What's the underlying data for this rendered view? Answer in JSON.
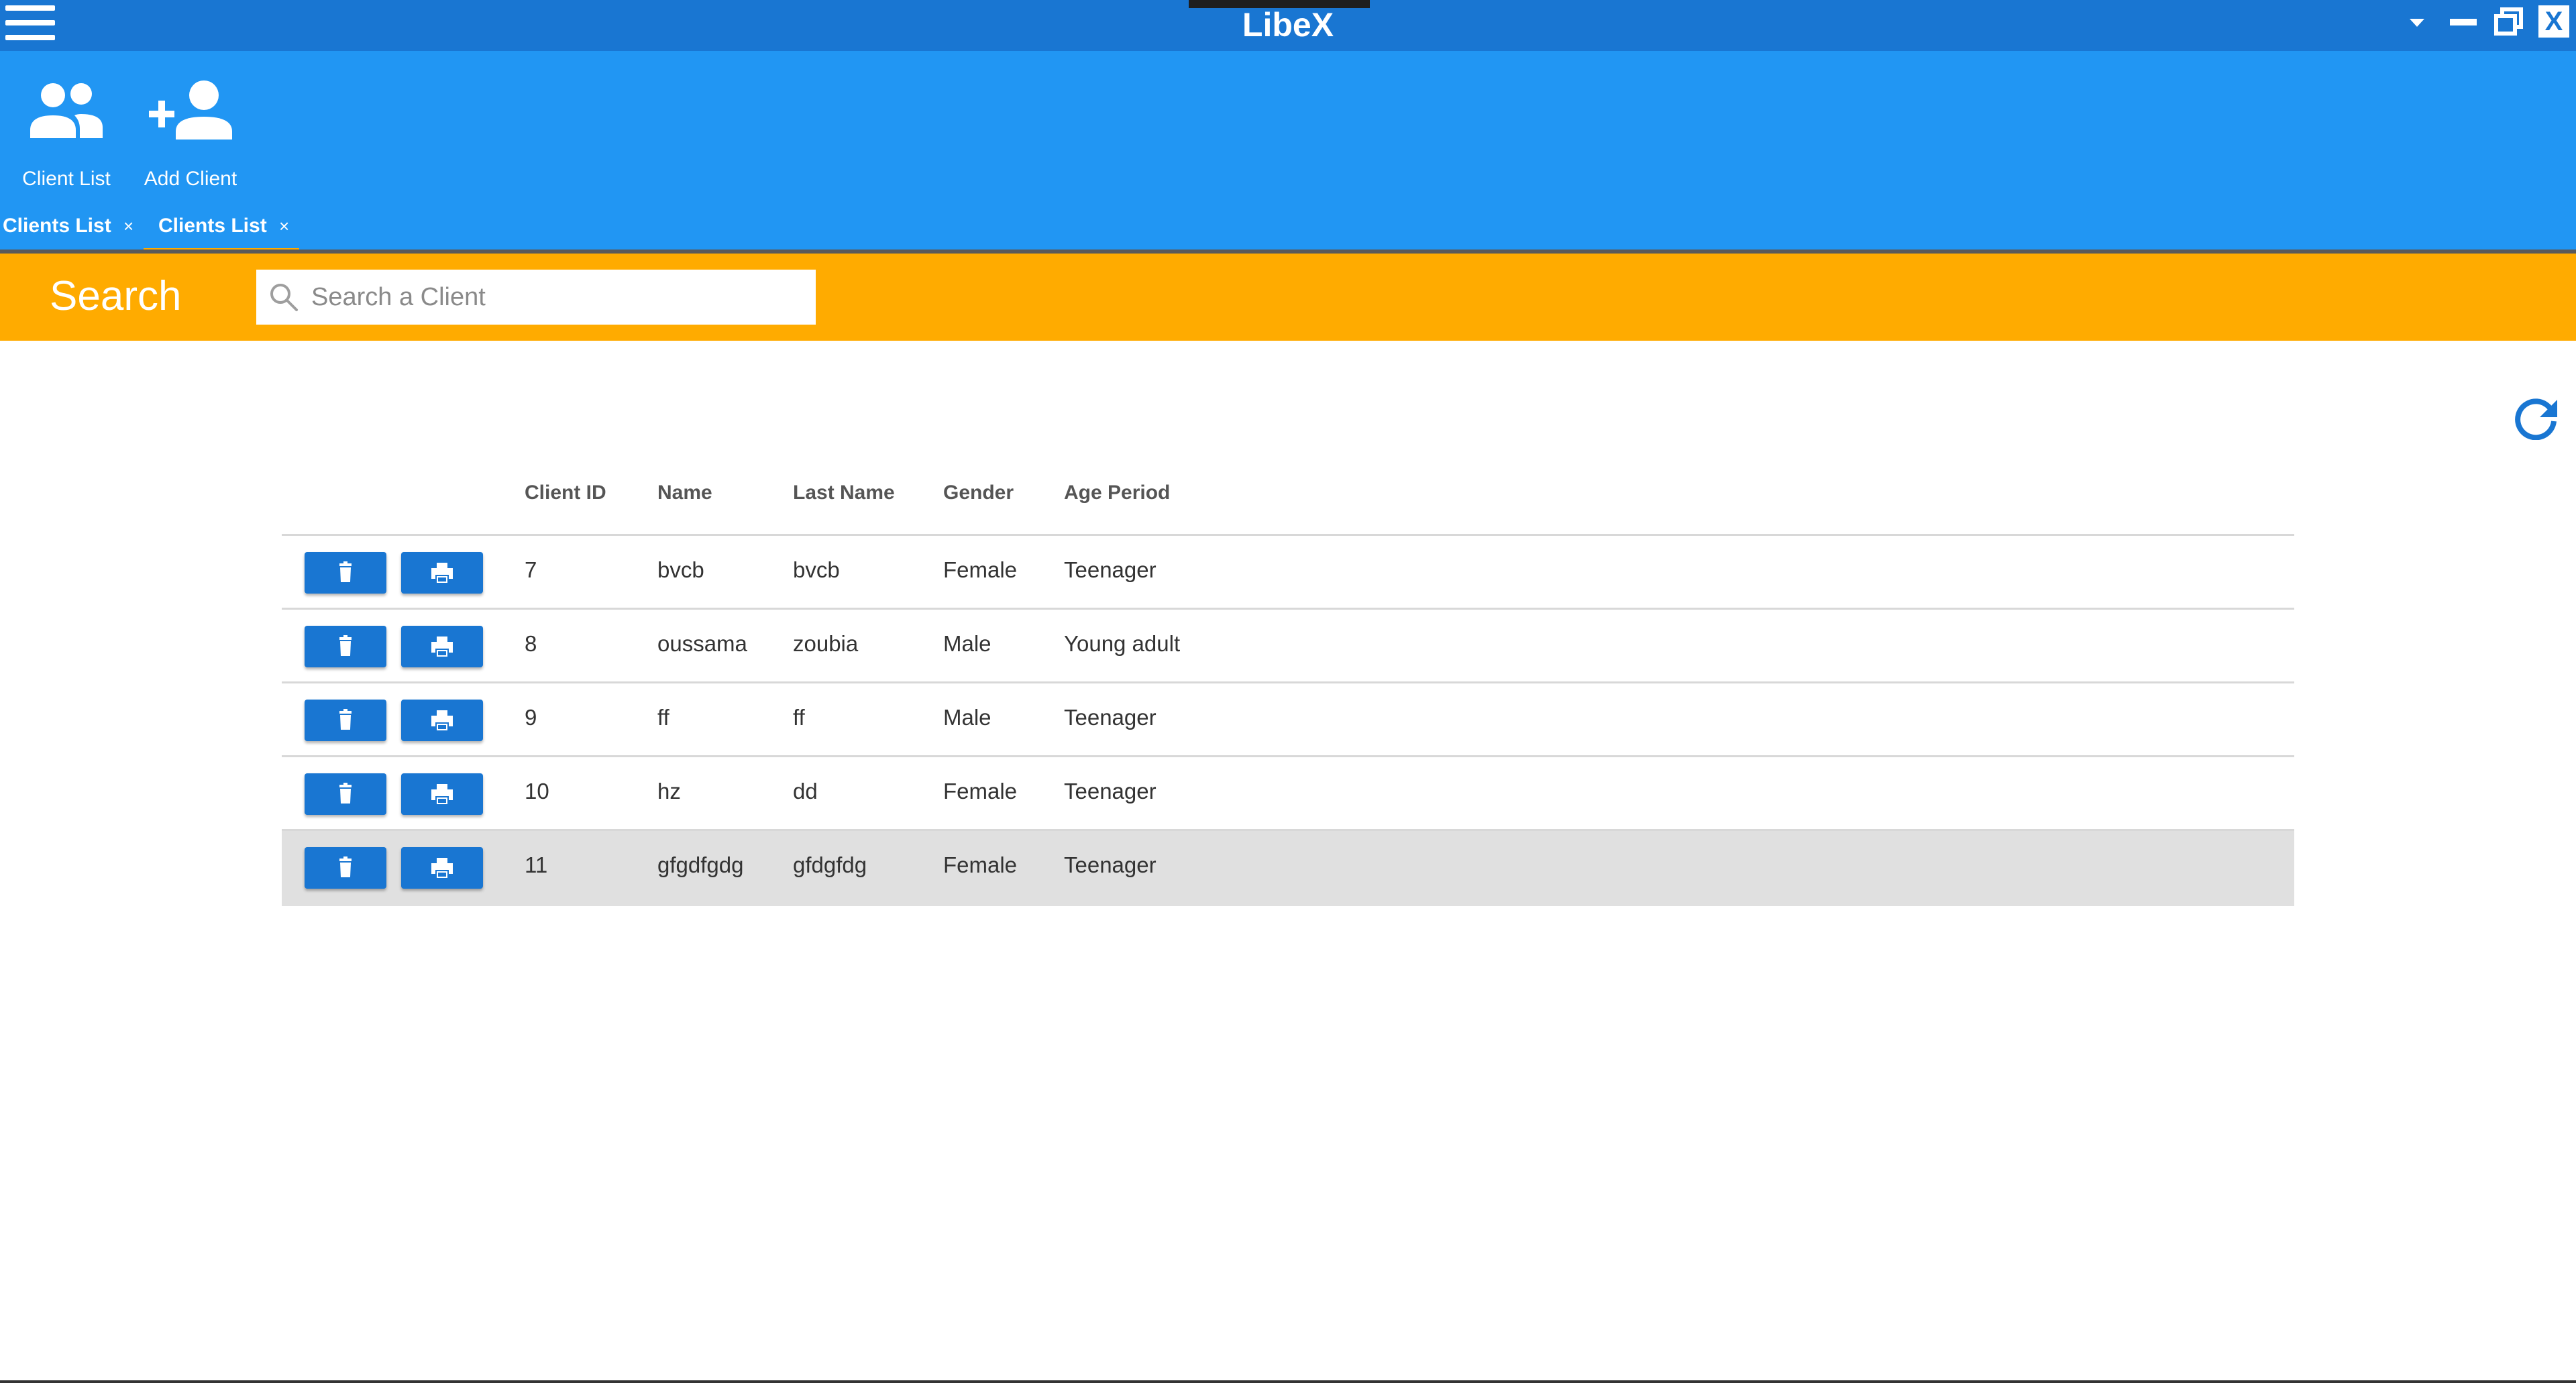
{
  "app": {
    "title": "LibeX"
  },
  "icons": {
    "menu": "hamburger-menu-icon",
    "dropdown": "chevron-down-icon",
    "minimize": "minimize-icon",
    "restore": "restore-icon",
    "close": "close-icon",
    "client_list": "people-icon",
    "add_client": "add-person-icon",
    "search": "search-icon",
    "refresh": "refresh-icon",
    "delete": "trash-icon",
    "print": "printer-icon"
  },
  "window_controls": {
    "close_label": "X"
  },
  "ribbon": {
    "client_list_label": "Client List",
    "add_client_label": "Add Client"
  },
  "tabs": [
    {
      "label": "Clients List",
      "close": "×",
      "active": false
    },
    {
      "label": "Clients List",
      "close": "×",
      "active": true
    }
  ],
  "search": {
    "label": "Search",
    "placeholder": "Search a Client",
    "value": ""
  },
  "table": {
    "columns": [
      "Client ID",
      "Name",
      "Last Name",
      "Gender",
      "Age Period"
    ],
    "rows": [
      {
        "id": "7",
        "name": "bvcb",
        "last_name": "bvcb",
        "gender": "Female",
        "age_period": "Teenager",
        "selected": false
      },
      {
        "id": "8",
        "name": "oussama",
        "last_name": "zoubia",
        "gender": "Male",
        "age_period": "Young adult",
        "selected": false
      },
      {
        "id": "9",
        "name": "ff",
        "last_name": "ff",
        "gender": "Male",
        "age_period": "Teenager",
        "selected": false
      },
      {
        "id": "10",
        "name": "hz",
        "last_name": "dd",
        "gender": "Female",
        "age_period": "Teenager",
        "selected": false
      },
      {
        "id": "11",
        "name": "gfgdfgdg",
        "last_name": "gfdgfdg",
        "gender": "Female",
        "age_period": "Teenager",
        "selected": true
      }
    ]
  },
  "colors": {
    "titlebar": "#1976D2",
    "ribbon": "#2196F3",
    "accent": "#FFAB00",
    "button": "#1976D2",
    "selected_row": "#E0E0E0"
  }
}
